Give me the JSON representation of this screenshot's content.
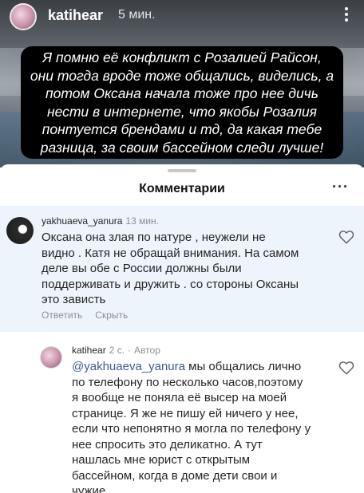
{
  "story": {
    "username": "katihear",
    "time": "5 мин.",
    "caption_lines": [
      "Я помню её конфликт с Розалией Райсон,",
      "они тогда вроде тоже общались, виделись, а",
      "потом Оксана начала тоже про нее дичь",
      "нести в интернете, что якобы Розалия",
      "понтуется брендами и тд, да какая тебе",
      "разница, за своим бассейном следи лучше!"
    ]
  },
  "sheet": {
    "title": "Комментарии",
    "more": "···"
  },
  "comments": [
    {
      "username": "yakhuaeva_yanura",
      "time": "13 мин.",
      "lines": [
        "Оксана она злая по натуре , неужели не",
        "видно . Катя не обращай внимания. На самом",
        "деле вы обе с России должны были",
        "поддерживать и дружить . со стороны Оксаны",
        "это зависть"
      ],
      "reply_label": "Ответить",
      "hide_label": "Скрыть"
    },
    {
      "username": "katihear",
      "time": "2 с.",
      "author_label": "Автор",
      "mention": "@yakhuaeva_yanura",
      "first_line_rest": " мы общались лично",
      "lines": [
        "по телефону по несколько часов,поэтому",
        "я вообще не поняла её высер на моей",
        "странице. Я же не пишу ей ничего у нее,",
        "если что непонятно я могла по телефону у",
        "нее спросить это деликатно. А тут",
        "нашлась мне юрист с открытым",
        "бассейном, когда в доме дети свои и",
        "чужие"
      ]
    }
  ],
  "icons": {
    "heart": "heart-icon",
    "more": "more-vertical-icon"
  }
}
